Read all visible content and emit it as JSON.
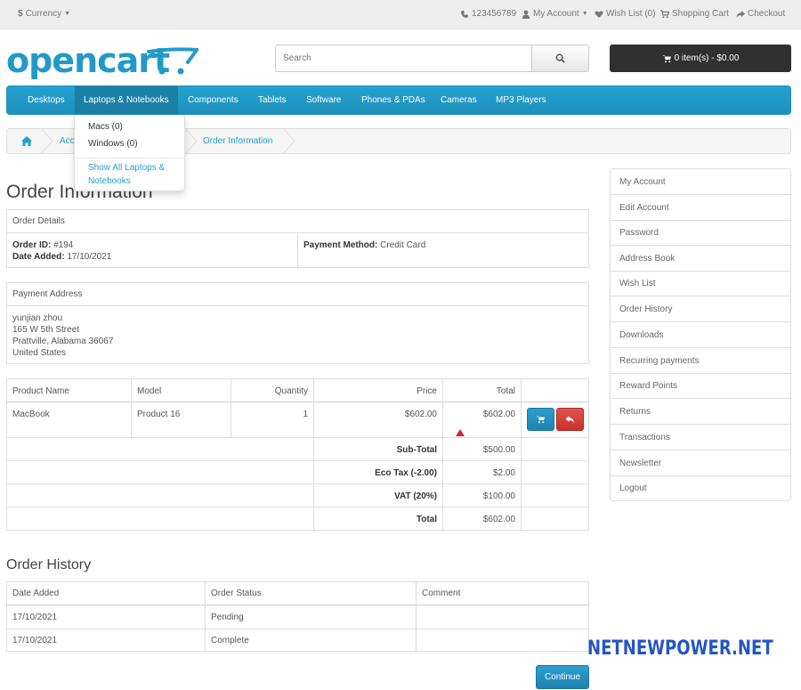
{
  "topbar": {
    "currency": "Currency",
    "phone": "123456789",
    "my_account": "My Account",
    "wish_list": "Wish List (0)",
    "shopping_cart": "Shopping Cart",
    "checkout": "Checkout"
  },
  "header": {
    "logo_text": "opencart",
    "search_placeholder": "Search",
    "cart_label": "0 item(s) - $0.00"
  },
  "nav": {
    "items": [
      "Desktops",
      "Laptops & Notebooks",
      "Components",
      "Tablets",
      "Software",
      "Phones & PDAs",
      "Cameras",
      "MP3 Players"
    ],
    "active_index": 1
  },
  "dropdown": {
    "items": [
      "Macs (0)",
      "Windows (0)"
    ],
    "show_all": "Show All Laptops & Notebooks"
  },
  "breadcrumb": {
    "items": [
      "Acc",
      "Order Information"
    ]
  },
  "page_title": "Order Information",
  "order_details": {
    "heading": "Order Details",
    "order_id_label": "Order ID:",
    "order_id": "#194",
    "date_added_label": "Date Added:",
    "date_added": "17/10/2021",
    "payment_method_label": "Payment Method:",
    "payment_method": "Credit Card"
  },
  "payment_address": {
    "heading": "Payment Address",
    "lines": [
      "yunjian zhou",
      "165 W 5th Street",
      "Prattville, Alabama 36067",
      "United States"
    ]
  },
  "products": {
    "headers": [
      "Product Name",
      "Model",
      "Quantity",
      "Price",
      "Total"
    ],
    "rows": [
      {
        "name": "MacBook",
        "model": "Product 16",
        "quantity": "1",
        "price": "$602.00",
        "total": "$602.00"
      }
    ],
    "totals": [
      {
        "label": "Sub-Total",
        "value": "$500.00"
      },
      {
        "label": "Eco Tax (-2.00)",
        "value": "$2.00"
      },
      {
        "label": "VAT (20%)",
        "value": "$100.00"
      },
      {
        "label": "Total",
        "value": "$602.00"
      }
    ]
  },
  "order_history": {
    "title": "Order History",
    "headers": [
      "Date Added",
      "Order Status",
      "Comment"
    ],
    "rows": [
      {
        "date": "17/10/2021",
        "status": "Pending",
        "comment": ""
      },
      {
        "date": "17/10/2021",
        "status": "Complete",
        "comment": ""
      }
    ]
  },
  "continue_label": "Continue",
  "account_menu": [
    "My Account",
    "Edit Account",
    "Password",
    "Address Book",
    "Wish List",
    "Order History",
    "Downloads",
    "Recurring payments",
    "Reward Points",
    "Returns",
    "Transactions",
    "Newsletter",
    "Logout"
  ],
  "watermark": "NETNEWPOWER.NET",
  "colors": {
    "brand_blue": "#229ac8",
    "nav_blue": "#1f90bb",
    "button_red": "#c9302c",
    "watermark_blue": "#2455c3"
  }
}
